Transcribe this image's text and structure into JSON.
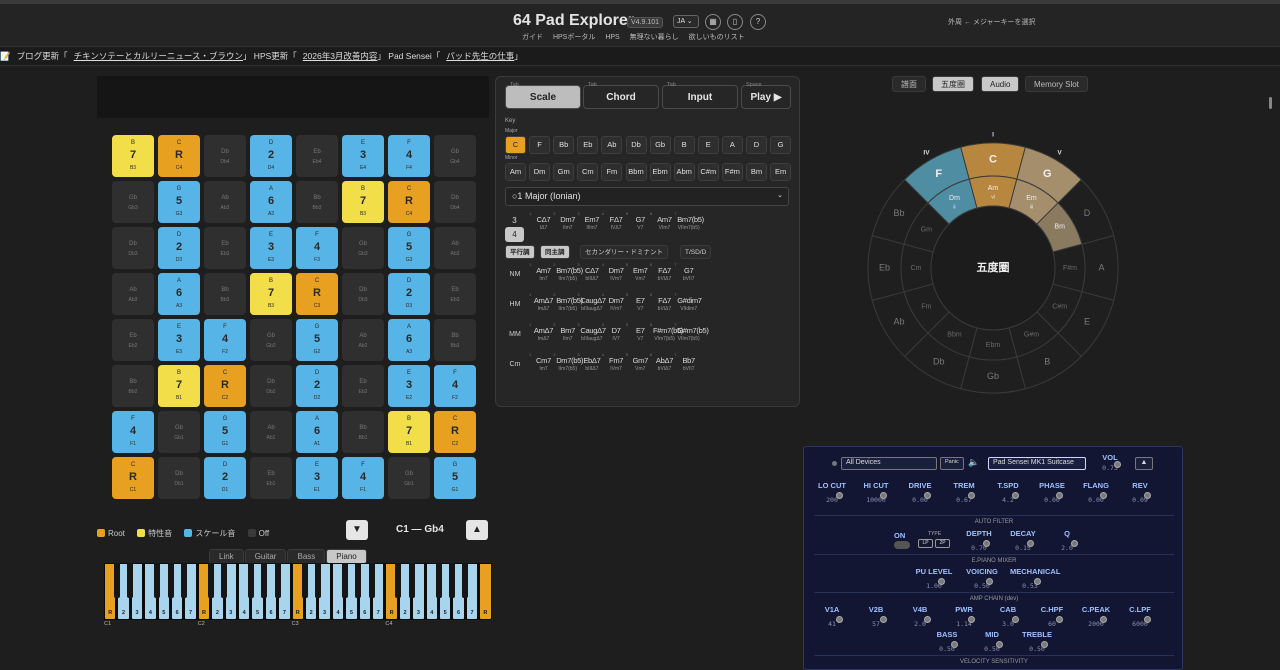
{
  "header": {
    "title": "64 Pad Explorer",
    "version": "V4.9.101",
    "lang": "JA ⌄",
    "links": [
      "ガイド",
      "HPSポータル",
      "HPS",
      "無理ない暮らし",
      "欲しいものリスト"
    ],
    "preset": "外周 ← メジャーキーを選択",
    "icons": [
      "grid-icon",
      "tablet-icon",
      "help-icon"
    ],
    "help_glyph": "?"
  },
  "news": {
    "i1": "ブログ更新「",
    "i1l": "チキンソテーとカルリーニュース・ブラウン",
    "i2": "」 HPS更新「",
    "i2l": "2026年3月改善内容",
    "i3": "」 Pad Sensei「",
    "i3l": "パッド先生の仕事",
    "i3e": "」"
  },
  "pads": [
    [
      "B|7|B3|ch",
      "C|R|C4|rt",
      "Db||Db4|off",
      "D|2|D4|sc",
      "Eb||Eb4|off",
      "E|3|E4|sc",
      "F|4|F4|sc",
      "Gb||Gb4|off"
    ],
    [
      "Gb||Gb3|off",
      "G|5|G3|sc",
      "Ab||Ab3|off",
      "A|6|A3|sc",
      "Bb||Bb3|off",
      "B|7|B3|ch",
      "C|R|C4|rt",
      "Db||Db4|off"
    ],
    [
      "Db||Db3|off",
      "D|2|D3|sc",
      "Eb||Eb3|off",
      "E|3|E3|sc",
      "F|4|F3|sc",
      "Gb||Gb3|off",
      "G|5|G3|sc",
      "Ab||Ab3|off"
    ],
    [
      "Ab||Ab3|off",
      "A|6|A3|sc",
      "Bb||Bb3|off",
      "B|7|B3|ch",
      "C|R|C3|rt",
      "Db||Db3|off",
      "D|2|D3|sc",
      "Eb||Eb3|off"
    ],
    [
      "Eb||Eb2|off",
      "E|3|E3|sc",
      "F|4|F2|sc",
      "Gb||Gb2|off",
      "G|5|G2|sc",
      "Ab||Ab2|off",
      "A|6|A3|sc",
      "Bb||Bb3|off"
    ],
    [
      "Bb||Bb2|off",
      "B|7|B1|ch",
      "C|R|C2|rt",
      "Db||Db2|off",
      "D|2|D2|sc",
      "Eb||Eb2|off",
      "E|3|E2|sc",
      "F|4|F2|sc"
    ],
    [
      "F|4|F1|sc",
      "Gb||Gb1|off",
      "G|5|G1|sc",
      "Ab||Ab1|off",
      "A|6|A1|sc",
      "Bb||Bb1|off",
      "B|7|B1|ch",
      "C|R|C2|rt"
    ],
    [
      "C|R|C1|rt",
      "Db||Db1|off",
      "D|2|D1|sc",
      "Eb||Eb1|off",
      "E|3|E1|sc",
      "F|4|F1|sc",
      "Gb||Gb1|off",
      "G|5|G1|sc"
    ]
  ],
  "legend": [
    "Root",
    "特性音",
    "スケール音",
    "Off"
  ],
  "range": {
    "label": "C1 — Gb4",
    "down": "▼",
    "up": "▲"
  },
  "ktabs": [
    "Link",
    "Guitar",
    "Bass",
    "Piano"
  ],
  "klabels": [
    "R",
    "2",
    "3",
    "4",
    "5",
    "6",
    "7"
  ],
  "koct": [
    "C1",
    "C2",
    "C3",
    "C4"
  ],
  "mode": {
    "tabs": [
      {
        "h": "Tab",
        "l": "Scale"
      },
      {
        "h": "Tab",
        "l": "Chord"
      },
      {
        "h": "Tab",
        "l": "Input"
      },
      {
        "h": "Space",
        "l": "Play ▶"
      }
    ]
  },
  "key": {
    "label": "Key",
    "major": "Major",
    "minor": "Minor",
    "majors": [
      "C",
      "F",
      "Bb",
      "Eb",
      "Ab",
      "Db",
      "Gb",
      "B",
      "E",
      "A",
      "D",
      "G"
    ],
    "minors": [
      "Am",
      "Dm",
      "Gm",
      "Cm",
      "Fm",
      "Bbm",
      "Ebm",
      "Abm",
      "C#m",
      "F#m",
      "Bm",
      "Em"
    ]
  },
  "scale": "○1 Major (Ionian)",
  "nums": [
    "3",
    "4"
  ],
  "diat": [
    [
      "CΔ7",
      "IΔ7"
    ],
    [
      "Dm7",
      "IIm7"
    ],
    [
      "Em7",
      "IIIm7"
    ],
    [
      "FΔ7",
      "IVΔ7"
    ],
    [
      "G7",
      "V7"
    ],
    [
      "Am7",
      "VIm7"
    ],
    [
      "Bm7(b5)",
      "VIIm7(b5)"
    ]
  ],
  "pills": [
    "平行調",
    "同主調",
    "セカンダリー・ドミナント",
    "T/SD/D"
  ],
  "rows": [
    {
      "l": "NM",
      "c": [
        [
          "Am7",
          "Im7"
        ],
        [
          "Bm7(b5)",
          "IIm7(b5)"
        ],
        [
          "CΔ7",
          "bIIIΔ7"
        ],
        [
          "Dm7",
          "IVm7"
        ],
        [
          "Em7",
          "Vm7"
        ],
        [
          "FΔ7",
          "bVIΔ7"
        ],
        [
          "G7",
          "bVII7"
        ]
      ]
    },
    {
      "l": "HM",
      "c": [
        [
          "AmΔ7",
          "ImΔ7"
        ],
        [
          "Bm7(b5)",
          "IIm7(b5)"
        ],
        [
          "CaugΔ7",
          "bIIIaugΔ7"
        ],
        [
          "Dm7",
          "IVm7"
        ],
        [
          "E7",
          "V7"
        ],
        [
          "FΔ7",
          "bVIΔ7"
        ],
        [
          "G#dim7",
          "VIIdim7"
        ]
      ]
    },
    {
      "l": "MM",
      "c": [
        [
          "AmΔ7",
          "ImΔ7"
        ],
        [
          "Bm7",
          "IIm7"
        ],
        [
          "CaugΔ7",
          "bIIIaugΔ7"
        ],
        [
          "D7",
          "IV7"
        ],
        [
          "E7",
          "V7"
        ],
        [
          "F#m7(b5)",
          "VIm7(b5)"
        ],
        [
          "G#m7(b5)",
          "VIIm7(b5)"
        ]
      ]
    },
    {
      "l": "Cm",
      "c": [
        [
          "Cm7",
          "Im7"
        ],
        [
          "Dm7(b5)",
          "IIm7(b5)"
        ],
        [
          "EbΔ7",
          "bIIIΔ7"
        ],
        [
          "Fm7",
          "IVm7"
        ],
        [
          "Gm7",
          "Vm7"
        ],
        [
          "AbΔ7",
          "bVIΔ7"
        ],
        [
          "Bb7",
          "bVII7"
        ]
      ]
    }
  ],
  "viewtabs": [
    "譜面",
    "五度圏",
    "Audio",
    "Memory Slot"
  ],
  "cof": {
    "center": "五度圏",
    "outer": [
      "C",
      "G",
      "D",
      "A",
      "E",
      "B",
      "F#",
      "Db",
      "Gb",
      "Ab",
      "Eb",
      "Bb",
      "F"
    ],
    "inner": [
      "Am",
      "Em",
      "Bm",
      "F#m",
      "C#m",
      "G#m",
      "Ebm",
      "Bbm",
      "Fm",
      "Cm",
      "Gm",
      "Dm"
    ],
    "roman": [
      "I",
      "V",
      "IV"
    ],
    "inner_roman": [
      "vi",
      "iii",
      "ii"
    ]
  },
  "synth": {
    "dev": "All Devices",
    "panic": "Panic",
    "prof": "Pad Sensei MK1 Suitcase",
    "vol": "VOL",
    "volv": "0.73",
    "up": "▲",
    "k1": [
      [
        "LO CUT",
        "200"
      ],
      [
        "HI CUT",
        "10000"
      ],
      [
        "DRIVE",
        "0.00"
      ],
      [
        "TREM",
        "0.67"
      ],
      [
        "T.SPD",
        "4.2"
      ],
      [
        "PHASE",
        "0.00"
      ],
      [
        "FLANG",
        "0.00"
      ],
      [
        "REV",
        "0.09"
      ]
    ],
    "af": "AUTO FILTER",
    "on": "ON",
    "type": "TYPE",
    "lp": "LP",
    "bp": "2P",
    "k2": [
      [
        "DEPTH",
        "0.70"
      ],
      [
        "DECAY",
        "0.15"
      ],
      [
        "Q",
        "2.0"
      ]
    ],
    "ep": "E.PIANO MIXER",
    "k3": [
      [
        "PU LEVEL",
        "1.00"
      ],
      [
        "VOICING",
        "0.50"
      ],
      [
        "MECHANICAL",
        "0.53"
      ]
    ],
    "amp": "AMP CHAIN (dev)",
    "k4": [
      [
        "V1A",
        "41"
      ],
      [
        "V2B",
        "57"
      ],
      [
        "V4B",
        "2.0"
      ],
      [
        "PWR",
        "1.14"
      ],
      [
        "CAB",
        "3.0"
      ],
      [
        "C.HPF",
        "60"
      ],
      [
        "C.PEAK",
        "2000"
      ],
      [
        "C.LPF",
        "6000"
      ]
    ],
    "k5": [
      [
        "BASS",
        "0.50"
      ],
      [
        "MID",
        "0.50"
      ],
      [
        "TREBLE",
        "0.50"
      ]
    ],
    "vs": "VELOCITY SENSITIVITY"
  }
}
